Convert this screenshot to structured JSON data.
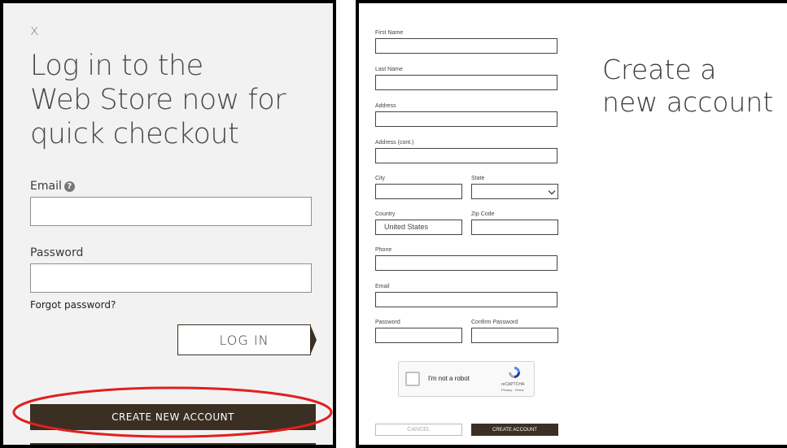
{
  "login_panel": {
    "close_label": "x",
    "headline": "Log in to the\nWeb Store now for\nquick checkout",
    "email_label": "Email",
    "help_icon": "?",
    "password_label": "Password",
    "forgot_link": "Forgot password?",
    "login_button": "LOG IN",
    "create_button": "CREATE NEW ACCOUNT",
    "highlight_color": "#e0201f"
  },
  "signup_form": {
    "heading": "Create a\nnew account",
    "first_name_label": "First Name",
    "last_name_label": "Last Name",
    "address_label": "Address",
    "address2_label": "Address (cont.)",
    "city_label": "City",
    "state_label": "State",
    "country_label": "Country",
    "country_value": "United States",
    "zip_label": "Zip Code",
    "phone_label": "Phone",
    "email_label": "Email",
    "password_label": "Password",
    "confirm_password_label": "Confirm Password",
    "captcha": {
      "text": "I'm not a robot",
      "brand": "reCAPTCHA",
      "links": "Privacy - Terms"
    },
    "cancel_button": "CANCEL",
    "create_button": "CREATE ACCOUNT"
  },
  "colors": {
    "brand_dark": "#3a2f22",
    "panel_bg": "#f2f2f2"
  }
}
